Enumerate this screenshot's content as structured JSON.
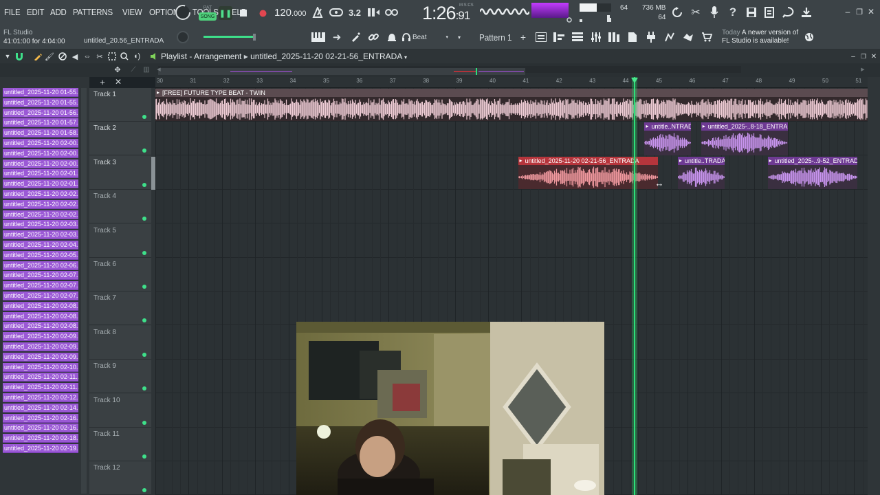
{
  "menu": [
    "FILE",
    "EDIT",
    "ADD",
    "PATTERNS",
    "VIEW",
    "OPTIONS",
    "TOOLS",
    "HELP"
  ],
  "transport": {
    "pat_label": "PAT",
    "song_label": "SONG",
    "tempo_main": "120",
    "tempo_dec": ".000",
    "time_main": "1:26",
    "time_sub": "91",
    "time_units": "M:S:CS",
    "step_readout": "3.2"
  },
  "monitor": {
    "cpu_value": "64",
    "memory": "736 MB",
    "poly": "64",
    "cpu_bar_fraction": 0.55
  },
  "hint": {
    "app": "FL Studio",
    "position": "41:01:00 for 4:04:00",
    "song_file": "untitled_20.56_ENTRADA"
  },
  "snap": {
    "value": "Beat",
    "pattern": "Pattern 1"
  },
  "news": {
    "when": "Today",
    "line1": "A newer version of",
    "line2": "FL Studio is available!"
  },
  "playlist": {
    "title": "Playlist - Arrangement",
    "arrangement": "untitled_2025-11-20 02-21-56_ENTRADA"
  },
  "ruler": [
    "30",
    "31",
    "32",
    "33",
    "34",
    "35",
    "36",
    "37",
    "38",
    "39",
    "40",
    "41",
    "42",
    "43",
    "44",
    "45",
    "46",
    "47",
    "48",
    "49",
    "50",
    "51"
  ],
  "picker": [
    "untitled_2025-11-20 01-55...",
    "untitled_2025-11-20 01-55...",
    "untitled_2025-11-20 01-56...",
    "untitled_2025-11-20 01-57...",
    "untitled_2025-11-20 01-58...",
    "untitled_2025-11-20 02-00...",
    "untitled_2025-11-20 02-00...",
    "untitled_2025-11-20 02-00...",
    "untitled_2025-11-20 02-01...",
    "untitled_2025-11-20 02-01...",
    "untitled_2025-11-20 02-02...",
    "untitled_2025-11-20 02-02...",
    "untitled_2025-11-20 02-02...",
    "untitled_2025-11-20 02-03...",
    "untitled_2025-11-20 02-03...",
    "untitled_2025-11-20 02-04...",
    "untitled_2025-11-20 02-05...",
    "untitled_2025-11-20 02-06...",
    "untitled_2025-11-20 02-07...",
    "untitled_2025-11-20 02-07...",
    "untitled_2025-11-20 02-07...",
    "untitled_2025-11-20 02-08...",
    "untitled_2025-11-20 02-08...",
    "untitled_2025-11-20 02-08...",
    "untitled_2025-11-20 02-09...",
    "untitled_2025-11-20 02-09...",
    "untitled_2025-11-20 02-09...",
    "untitled_2025-11-20 02-10...",
    "untitled_2025-11-20 02-11...",
    "untitled_2025-11-20 02-11...",
    "untitled_2025-11-20 02-12...",
    "untitled_2025-11-20 02-14...",
    "untitled_2025-11-20 02-16...",
    "untitled_2025-11-20 02-16...",
    "untitled_2025-11-20 02-18...",
    "untitled_2025-11-20 02-19..."
  ],
  "tracks": [
    "Track 1",
    "Track 2",
    "Track 3",
    "Track 4",
    "Track 5",
    "Track 6",
    "Track 7",
    "Track 8",
    "Track 9",
    "Track 10",
    "Track 11",
    "Track 12"
  ],
  "clips": [
    {
      "track": 1,
      "label": "[FREE] FUTURE TYPE BEAT - TWIN",
      "start": 30.0,
      "end": 51.4,
      "color": "#e3b9c4",
      "header": "#5b4b50",
      "wave": "#f0cdd6"
    },
    {
      "track": 2,
      "label": "untitle..NTRADA",
      "start": 44.7,
      "end": 46.1,
      "color": "#b574e6",
      "header": "#6e3a93",
      "wave": "#c995f0"
    },
    {
      "track": 2,
      "label": "untitled_2025-..8-18_ENTRADA",
      "start": 46.4,
      "end": 49.0,
      "color": "#b574e6",
      "header": "#6e3a93",
      "wave": "#c995f0"
    },
    {
      "track": 3,
      "label": "untitled_2025-11-20 02-21-56_ENTRADA",
      "start": 40.9,
      "end": 45.1,
      "color": "#e77981",
      "header": "#b6353c",
      "wave": "#f29aa0"
    },
    {
      "track": 3,
      "label": "untitle..TRADA",
      "start": 45.7,
      "end": 47.1,
      "color": "#b574e6",
      "header": "#6e3a93",
      "wave": "#c995f0"
    },
    {
      "track": 3,
      "label": "untitled_2025-..9-52_ENTRADA",
      "start": 48.4,
      "end": 51.1,
      "color": "#b574e6",
      "header": "#6e3a93",
      "wave": "#c995f0"
    }
  ],
  "playhead_bar": 44.4,
  "colors": {
    "accent_green": "#2ee07a",
    "picker_purple": "#9b59d6",
    "song_mode": "#4fd17c"
  },
  "icons": [
    "hint-arrow-icon",
    "magnet-icon",
    "pencil-icon",
    "paint-icon",
    "delete-icon",
    "mute-icon",
    "slice-icon",
    "select-icon",
    "zoom-icon",
    "playback-icon",
    "play-icon",
    "stop-icon",
    "record-icon",
    "metronome-icon",
    "wait-icon",
    "countdown-icon",
    "loop-record-icon",
    "undo-icon",
    "cut-icon",
    "mic-icon",
    "help-icon",
    "save-icon",
    "render-icon",
    "chat-icon",
    "download-icon",
    "piano-roll-icon",
    "arrow-icon",
    "link-icon",
    "bell-icon",
    "headphones-icon",
    "plus-icon",
    "globe-icon"
  ]
}
